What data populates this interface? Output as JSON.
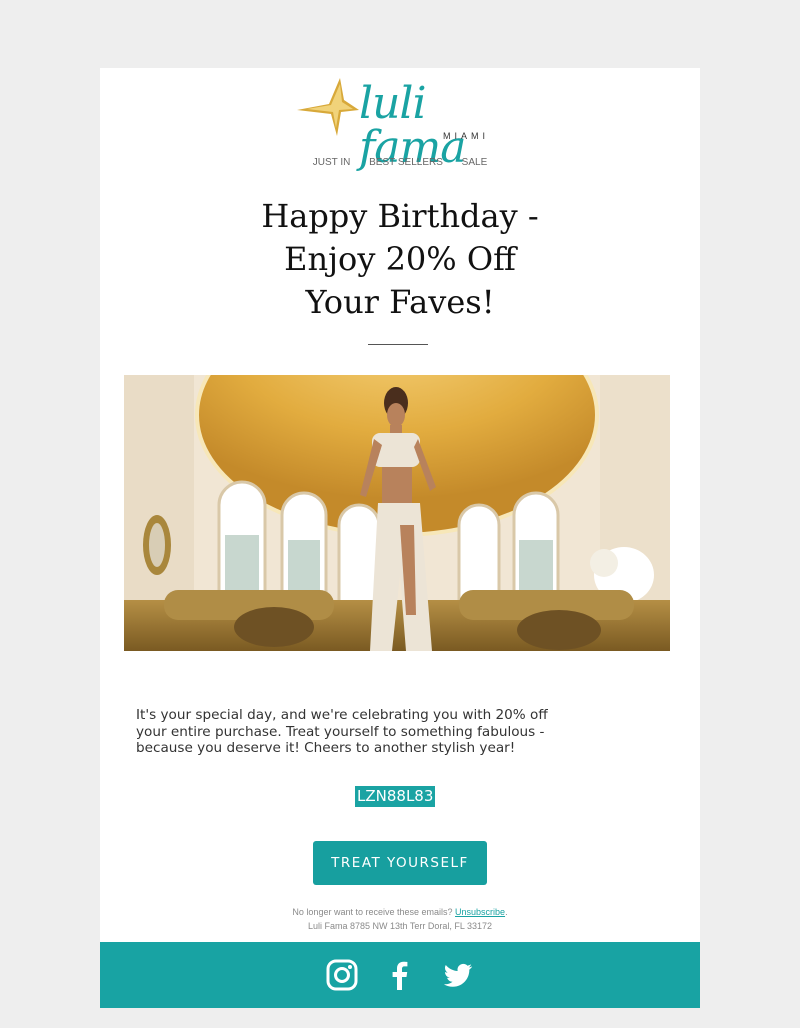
{
  "brand": {
    "logo_wordmark": "luli fama",
    "logo_subtext": "MIAMI",
    "accent_color": "#1aa3a3",
    "logo_gold": "#d8a93a"
  },
  "nav": {
    "items": [
      {
        "label": "JUST IN"
      },
      {
        "label": "BEST SELLERS"
      },
      {
        "label": "SALE"
      }
    ]
  },
  "headline": {
    "line1": "Happy Birthday -",
    "line2": "Enjoy 20% Off",
    "line3": "Your Faves!"
  },
  "hero": {
    "alt": "Model in a white crop top and sarong skirt in an ornate golden room",
    "palette": {
      "ceiling": "#e6b74a",
      "walls": "#efe3cf",
      "sofa": "#a8823a",
      "outfit": "#ece4d6",
      "skin": "#b8825c"
    }
  },
  "body": {
    "message": "It's your special day, and we're celebrating you with 20% off your entire purchase. Treat yourself to something fabulous - because you deserve it! Cheers to another stylish year!"
  },
  "coupon": {
    "code": "LZN88L83"
  },
  "cta": {
    "label": "TREAT YOURSELF"
  },
  "footer": {
    "unsubscribe_prefix": "No longer want to receive these emails?",
    "unsubscribe_label": "Unsubscribe",
    "unsubscribe_suffix": ".",
    "address": "Luli Fama 8785 NW 13th Terr Doral, FL 33172"
  },
  "social": {
    "background": "#18a3a3",
    "icons": [
      "instagram-icon",
      "facebook-icon",
      "twitter-icon"
    ]
  }
}
